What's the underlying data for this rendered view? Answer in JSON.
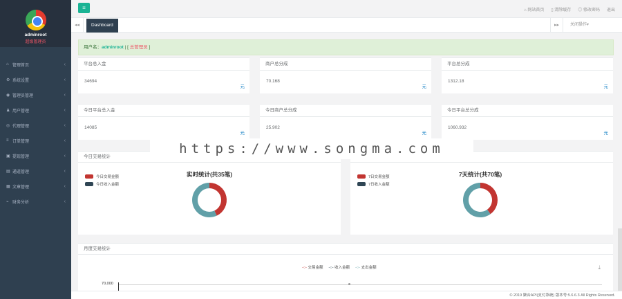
{
  "sidebar": {
    "user_name": "adminroot",
    "user_role": "超级管理员",
    "items": [
      {
        "icon": "home-icon",
        "glyph": "⌂",
        "label": "管理首页"
      },
      {
        "icon": "cogs-icon",
        "glyph": "⚙",
        "label": "系统设置"
      },
      {
        "icon": "user-circle-icon",
        "glyph": "◉",
        "label": "管理员管理"
      },
      {
        "icon": "users-icon",
        "glyph": "♟",
        "label": "用户管理"
      },
      {
        "icon": "eye-icon",
        "glyph": "◎",
        "label": "代理管理"
      },
      {
        "icon": "list-icon",
        "glyph": "≡",
        "label": "订单管理"
      },
      {
        "icon": "lock-icon",
        "glyph": "▣",
        "label": "提现管理"
      },
      {
        "icon": "channel-icon",
        "glyph": "▤",
        "label": "通道管理"
      },
      {
        "icon": "file-icon",
        "glyph": "▦",
        "label": "文章管理"
      },
      {
        "icon": "chart-icon",
        "glyph": "⌁",
        "label": "财务分析"
      }
    ]
  },
  "topbar": {
    "links": [
      {
        "icon": "home-icon",
        "label": "⌂ 网站首页"
      },
      {
        "icon": "trash-icon",
        "label": "▯ 清除缓存"
      },
      {
        "icon": "eye-icon",
        "label": "◎ 修改密码"
      },
      {
        "icon": "logout-icon",
        "label": "退出"
      }
    ]
  },
  "tabs": {
    "active": "Dashboard",
    "close_label": "关闭操作▾"
  },
  "alert": {
    "prefix": "用户名：",
    "username": "adminroot",
    "sep_open": " | [ ",
    "link": "总管理员",
    "sep_close": " ]"
  },
  "cards": [
    {
      "title": "平台总入金",
      "value": "34694",
      "unit": "元"
    },
    {
      "title": "商户总分成",
      "value": "70.168",
      "unit": "元"
    },
    {
      "title": "平台总分成",
      "value": "1312.18",
      "unit": "元"
    },
    {
      "title": "今日平台总入金",
      "value": "14085",
      "unit": "元"
    },
    {
      "title": "今日商户总分成",
      "value": "25.902",
      "unit": "元"
    },
    {
      "title": "今日平台总分成",
      "value": "1060.932",
      "unit": "元"
    }
  ],
  "panels": [
    {
      "title": "今日交易统计",
      "chart_title": "实时统计(共35笔)",
      "legend": [
        "今日交易金额",
        "今日收入金额"
      ]
    },
    {
      "title": "",
      "chart_title": "7天统计(共70笔)",
      "legend": [
        "7日交易金额",
        "7日收入金额"
      ]
    }
  ],
  "chart_data": [
    {
      "type": "pie",
      "title": "实时统计(共35笔)",
      "series": [
        {
          "name": "今日交易金额",
          "value": 0.43,
          "color": "#c23531"
        },
        {
          "name": "今日收入金额",
          "value": 0.57,
          "color": "#61a0a8"
        }
      ]
    },
    {
      "type": "pie",
      "title": "7天统计(共70笔)",
      "series": [
        {
          "name": "7日交易金额",
          "value": 0.4,
          "color": "#c23531"
        },
        {
          "name": "7日收入金额",
          "value": 0.6,
          "color": "#61a0a8"
        }
      ]
    },
    {
      "type": "line",
      "title": "月度交易统计",
      "legend": [
        "交易金额",
        "收入金额",
        "支出金额"
      ],
      "y_first_tick": "70,000"
    }
  ],
  "monthly": {
    "title": "月度交易统计",
    "legend": [
      "交易金额",
      "收入金额",
      "支出金额"
    ],
    "y_tick": "70,000"
  },
  "watermark": "https://www.songma.com",
  "footer": "© 2019 聚合API(支付系统) 版本号:5.6.6.3 All Rights Reserved.",
  "colors": {
    "primary": "#1ab394",
    "sidebar": "#2f4050",
    "danger": "#c23531",
    "teal": "#61a0a8",
    "dark": "#2f4554"
  }
}
